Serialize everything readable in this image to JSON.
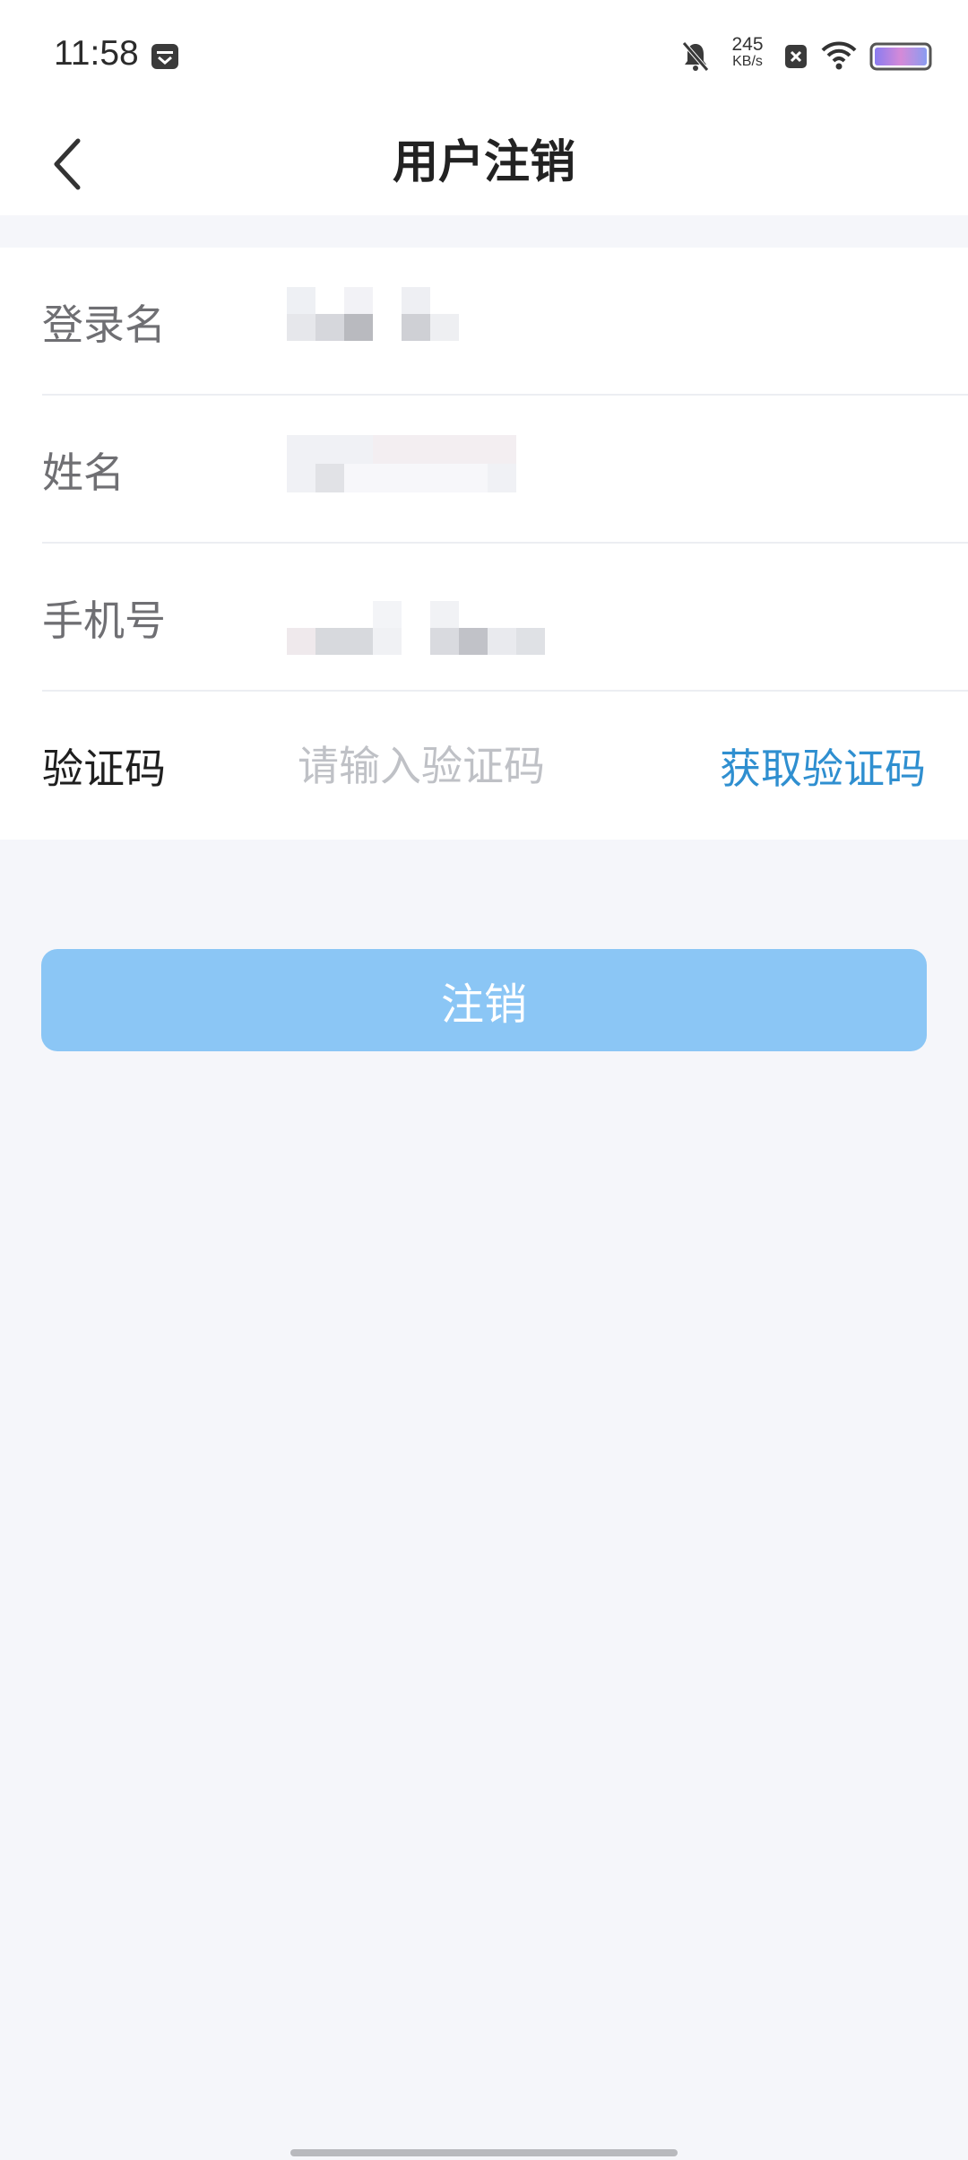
{
  "status_bar": {
    "time": "11:58",
    "net_speed_value": "245",
    "net_speed_unit": "KB/s",
    "icons": [
      "calendar-app-icon",
      "bell-muted-icon",
      "close-square-icon",
      "wifi-icon",
      "battery-icon"
    ]
  },
  "header": {
    "title": "用户注销",
    "back_icon": "chevron-left-icon"
  },
  "form": {
    "rows": [
      {
        "label": "登录名"
      },
      {
        "label": "姓名"
      },
      {
        "label": "手机号"
      },
      {
        "label": "验证码",
        "placeholder": "请输入验证码",
        "action_label": "获取验证码"
      }
    ]
  },
  "submit": {
    "label": "注销"
  },
  "colors": {
    "accent": "#2f8fd0",
    "button_disabled": "#8bc6f5",
    "page_background": "#f5f6fa"
  }
}
